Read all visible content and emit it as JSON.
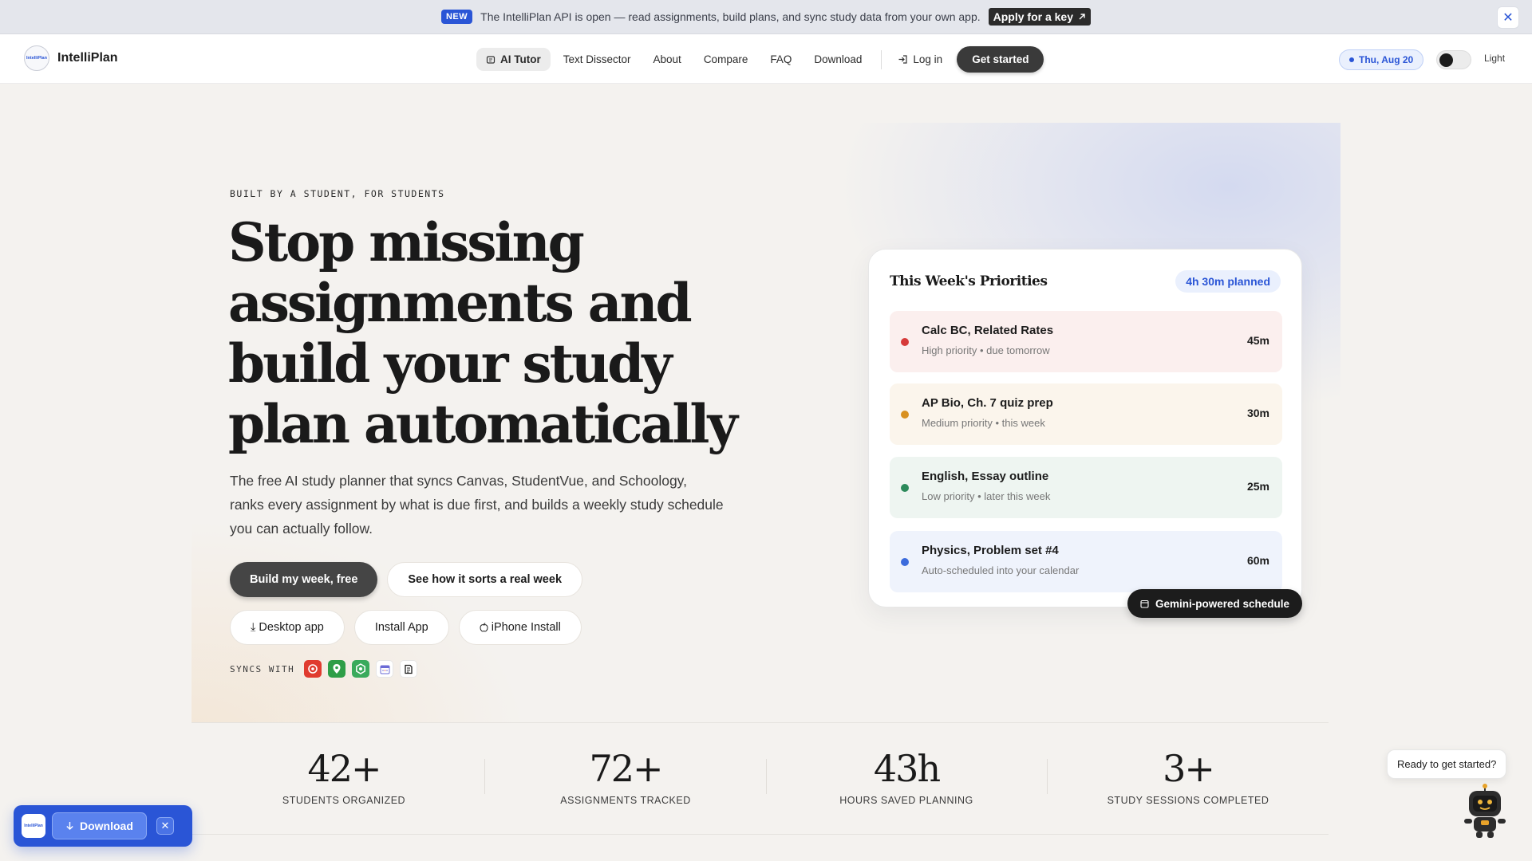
{
  "announcement": {
    "badge": "NEW",
    "text": "The IntelliPlan API is open — read assignments, build plans, and sync study data from your own app.",
    "link_label": "Apply for a key",
    "link_icon": "arrow-up-right-icon",
    "close_icon": "close-icon"
  },
  "nav": {
    "brand_name": "IntelliPlan",
    "logo_text": "IntelliPlan",
    "links": [
      {
        "label": "AI Tutor",
        "active": true,
        "icon": "tutor-icon"
      },
      {
        "label": "Text Dissector"
      },
      {
        "label": "About"
      },
      {
        "label": "Compare"
      },
      {
        "label": "FAQ"
      },
      {
        "label": "Download"
      }
    ],
    "login_label": "Log in",
    "get_started_label": "Get started",
    "date": "Thu, Aug 20",
    "theme_label": "Light"
  },
  "hero": {
    "eyebrow": "BUILT BY A STUDENT, FOR STUDENTS",
    "headline": "Stop missing assignments and build your study plan automatically",
    "subcopy": "The free AI study planner that syncs Canvas, StudentVue, and Schoology, ranks every assignment by what is due first, and builds a weekly study schedule you can actually follow.",
    "cta_primary": "Build my week, free",
    "cta_secondary": "See how it sorts a real week",
    "install": [
      {
        "label": "Desktop app",
        "icon": "download-icon",
        "glyph": "⤓"
      },
      {
        "label": "Install App"
      },
      {
        "label": "iPhone Install",
        "icon": "apple-icon",
        "glyph": ""
      }
    ],
    "syncs_label": "SYNCS WITH",
    "sync_icons": [
      {
        "name": "canvas-icon",
        "color": "#e03b2f",
        "glyph": "◉"
      },
      {
        "name": "studentvue-icon",
        "color": "#2e9e47",
        "glyph": "⬢"
      },
      {
        "name": "schoology-icon",
        "color": "#3aaa5c",
        "glyph": "◎"
      },
      {
        "name": "calendar-icon",
        "color": "#ffffff",
        "glyph": "▦"
      },
      {
        "name": "notes-icon",
        "color": "#ffffff",
        "glyph": "≣"
      }
    ]
  },
  "priorities": {
    "title": "This Week's Priorities",
    "planned": "4h 30m planned",
    "tasks": [
      {
        "name": "Calc BC, Related Rates",
        "meta": "High priority • due tomorrow",
        "duration": "45m",
        "dot": "#d63a3a",
        "bg": "#fbefee"
      },
      {
        "name": "AP Bio, Ch. 7 quiz prep",
        "meta": "Medium priority • this week",
        "duration": "30m",
        "dot": "#d8901f",
        "bg": "#fbf5ec"
      },
      {
        "name": "English, Essay outline",
        "meta": "Low priority • later this week",
        "duration": "25m",
        "dot": "#2c8a5b",
        "bg": "#eef5f1"
      },
      {
        "name": "Physics, Problem set #4",
        "meta": "Auto-scheduled into your calendar",
        "duration": "60m",
        "dot": "#3c6bdc",
        "bg": "#eff3fc"
      }
    ],
    "badge": "Gemini-powered schedule"
  },
  "stats": [
    {
      "value": "42+",
      "label": "STUDENTS ORGANIZED"
    },
    {
      "value": "72+",
      "label": "ASSIGNMENTS TRACKED"
    },
    {
      "value": "43h",
      "label": "HOURS SAVED PLANNING"
    },
    {
      "value": "3+",
      "label": "STUDY SESSIONS COMPLETED"
    }
  ],
  "download_widget": {
    "logo_text": "IntelliPlan",
    "button_label": "Download"
  },
  "chat": {
    "bubble": "Ready to get started?"
  }
}
